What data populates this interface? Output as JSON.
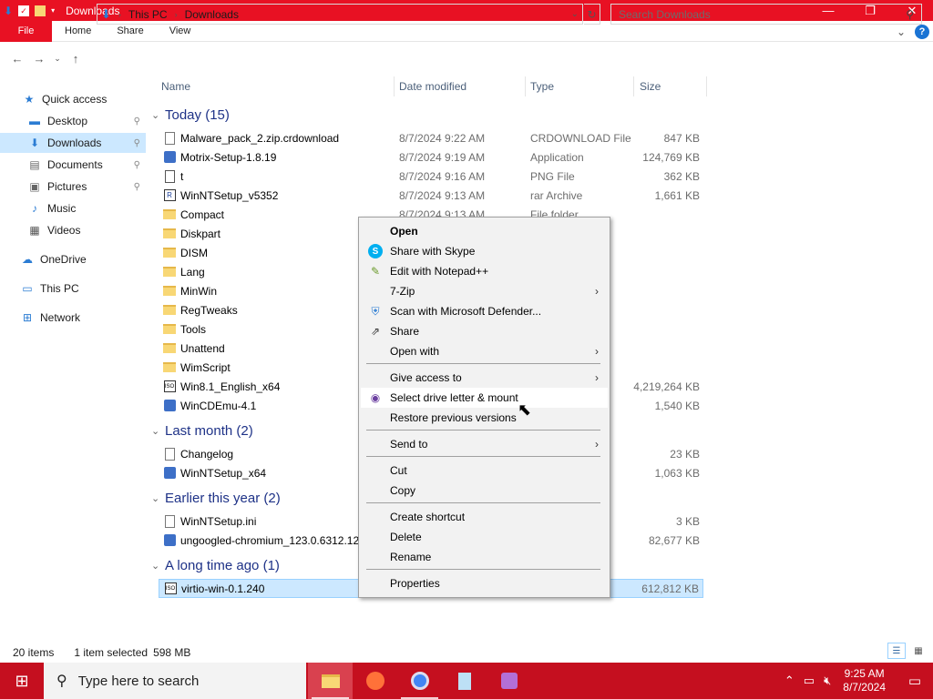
{
  "window": {
    "title": "Downloads",
    "minimize": "—",
    "maximize": "❐",
    "close": "✕"
  },
  "ribbon": {
    "tabs": [
      "File",
      "Home",
      "Share",
      "View"
    ],
    "collapse": "⌄",
    "help": "?"
  },
  "address": {
    "crumbs": [
      "This PC",
      "Downloads"
    ],
    "search_placeholder": "Search Downloads"
  },
  "nav": {
    "items": [
      {
        "label": "Quick access",
        "icon": "star-icon",
        "glyph": "★",
        "color": "#2b7cd3"
      },
      {
        "label": "Desktop",
        "icon": "desktop-icon",
        "glyph": "▬",
        "color": "#2b7cd3",
        "pinned": true
      },
      {
        "label": "Downloads",
        "icon": "download-icon",
        "glyph": "⬇",
        "color": "#2b7cd3",
        "pinned": true,
        "selected": true
      },
      {
        "label": "Documents",
        "icon": "documents-icon",
        "glyph": "▤",
        "color": "#666",
        "pinned": true
      },
      {
        "label": "Pictures",
        "icon": "pictures-icon",
        "glyph": "▣",
        "color": "#666",
        "pinned": true
      },
      {
        "label": "Music",
        "icon": "music-icon",
        "glyph": "♪",
        "color": "#2b7cd3"
      },
      {
        "label": "Videos",
        "icon": "videos-icon",
        "glyph": "▦",
        "color": "#555"
      },
      {
        "label": "OneDrive",
        "icon": "cloud-icon",
        "glyph": "☁",
        "color": "#2b7cd3"
      },
      {
        "label": "This PC",
        "icon": "computer-icon",
        "glyph": "▭",
        "color": "#2b7cd3"
      },
      {
        "label": "Network",
        "icon": "network-icon",
        "glyph": "⊞",
        "color": "#2b7cd3"
      }
    ]
  },
  "columns": {
    "name": "Name",
    "date": "Date modified",
    "type": "Type",
    "size": "Size"
  },
  "groups": [
    {
      "label": "Today (15)"
    },
    {
      "label": "Last month (2)"
    },
    {
      "label": "Earlier this year (2)"
    },
    {
      "label": "A long time ago (1)"
    }
  ],
  "files": [
    {
      "name": "Malware_pack_2.zip.crdownload",
      "date": "8/7/2024 9:22 AM",
      "type": "CRDOWNLOAD File",
      "size": "847 KB",
      "icon": "doc"
    },
    {
      "name": "Motrix-Setup-1.8.19",
      "date": "8/7/2024 9:19 AM",
      "type": "Application",
      "size": "124,769 KB",
      "icon": "app"
    },
    {
      "name": "t",
      "date": "8/7/2024 9:16 AM",
      "type": "PNG File",
      "size": "362 KB",
      "icon": "png"
    },
    {
      "name": "WinNTSetup_v5352",
      "date": "8/7/2024 9:13 AM",
      "type": "rar Archive",
      "size": "1,661 KB",
      "icon": "rar"
    },
    {
      "name": "Compact",
      "date": "8/7/2024 9:13 AM",
      "type": "File folder",
      "size": "",
      "icon": "folder"
    },
    {
      "name": "Diskpart",
      "date": "",
      "type": "",
      "size": "",
      "icon": "folder"
    },
    {
      "name": "DISM",
      "date": "",
      "type": "",
      "size": "",
      "icon": "folder"
    },
    {
      "name": "Lang",
      "date": "",
      "type": "",
      "size": "",
      "icon": "folder"
    },
    {
      "name": "MinWin",
      "date": "",
      "type": "",
      "size": "",
      "icon": "folder"
    },
    {
      "name": "RegTweaks",
      "date": "",
      "type": "",
      "size": "",
      "icon": "folder"
    },
    {
      "name": "Tools",
      "date": "",
      "type": "",
      "size": "",
      "icon": "folder"
    },
    {
      "name": "Unattend",
      "date": "",
      "type": "",
      "size": "",
      "icon": "folder"
    },
    {
      "name": "WimScript",
      "date": "",
      "type": "",
      "size": "",
      "icon": "folder"
    },
    {
      "name": "Win8.1_English_x64",
      "date": "",
      "type": "",
      "size": "4,219,264 KB",
      "icon": "iso"
    },
    {
      "name": "WinCDEmu-4.1",
      "date": "",
      "type": "",
      "size": "1,540 KB",
      "icon": "app"
    },
    {
      "name": "Changelog",
      "date": "",
      "type": "",
      "size": "23 KB",
      "icon": "doc"
    },
    {
      "name": "WinNTSetup_x64",
      "date": "",
      "type": "",
      "size": "1,063 KB",
      "icon": "app"
    },
    {
      "name": "WinNTSetup.ini",
      "date": "",
      "type": "",
      "size": "3 KB",
      "icon": "doc"
    },
    {
      "name": "ungoogled-chromium_123.0.6312.12",
      "date": "",
      "type": "",
      "size": "82,677 KB",
      "icon": "app"
    },
    {
      "name": "virtio-win-0.1.240",
      "date": "",
      "type": "",
      "size": "612,812 KB",
      "icon": "iso",
      "selected": true
    }
  ],
  "context_menu": [
    {
      "label": "Open",
      "bold": true
    },
    {
      "label": "Share with Skype",
      "icon": "skype-icon",
      "glyph": "S",
      "color": "#00aff0"
    },
    {
      "label": "Edit with Notepad++",
      "icon": "notepadpp-icon",
      "glyph": "✎",
      "color": "#6a9a2a"
    },
    {
      "label": "7-Zip",
      "submenu": true
    },
    {
      "label": "Scan with Microsoft Defender...",
      "icon": "defender-icon",
      "glyph": "⛨",
      "color": "#2b7cd3"
    },
    {
      "label": "Share",
      "icon": "share-icon",
      "glyph": "⇗",
      "color": "#333"
    },
    {
      "label": "Open with",
      "submenu": true
    },
    {
      "label": "Give access to",
      "submenu": true
    },
    {
      "label": "Select drive letter & mount",
      "icon": "wincdemu-icon",
      "glyph": "◉",
      "color": "#6b3fa0",
      "hover": true
    },
    {
      "label": "Restore previous versions"
    },
    {
      "label": "Send to",
      "submenu": true
    },
    {
      "label": "Cut"
    },
    {
      "label": "Copy"
    },
    {
      "label": "Create shortcut"
    },
    {
      "label": "Delete"
    },
    {
      "label": "Rename"
    },
    {
      "label": "Properties"
    }
  ],
  "status": {
    "items": "20 items",
    "selected": "1 item selected",
    "size": "598 MB"
  },
  "taskbar": {
    "search_placeholder": "Type here to search",
    "time": "9:25 AM",
    "date": "8/7/2024"
  }
}
